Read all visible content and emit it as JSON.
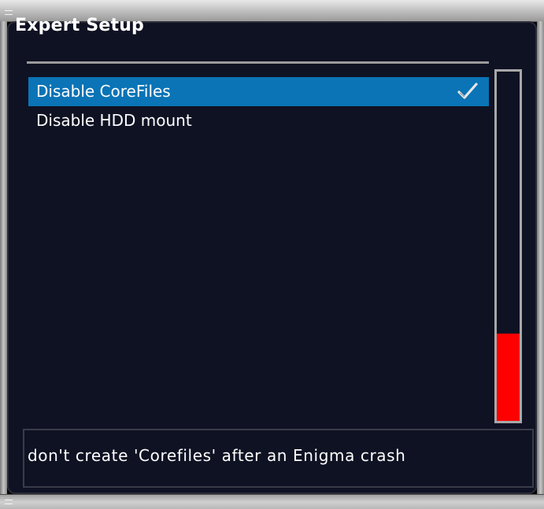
{
  "window": {
    "title": "Expert Setup"
  },
  "menu": {
    "items": [
      {
        "label": "Disable CoreFiles",
        "checked": true,
        "selected": true
      },
      {
        "label": "Disable HDD mount",
        "checked": false,
        "selected": false
      }
    ]
  },
  "level_bar": {
    "fill_fraction": 0.25,
    "fill_color": "#ff0000"
  },
  "description": {
    "text": "don't create 'Corefiles' after an Enigma crash"
  },
  "colors": {
    "selection": "#0a74b6",
    "background": "#0f1223",
    "text": "#ffffff"
  },
  "icons": {
    "check": "checkmark-icon"
  }
}
